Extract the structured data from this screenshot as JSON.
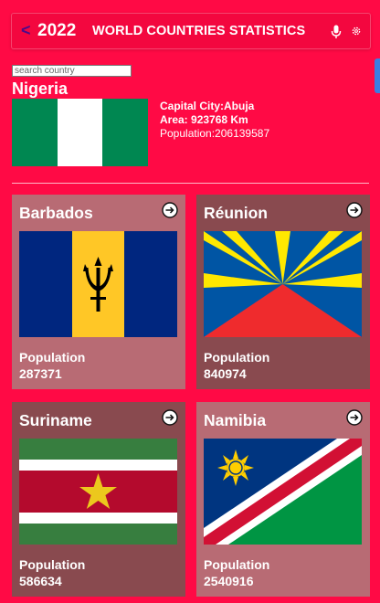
{
  "header": {
    "back_glyph": "<",
    "year": "2022",
    "title": "WORLD COUNTRIES STATISTICS",
    "icons": [
      "chevron-left-icon",
      "microphone-icon",
      "gear-icon"
    ]
  },
  "search": {
    "placeholder": "search country",
    "value": ""
  },
  "selected": {
    "name": "Nigeria",
    "capital": "Capital City:Abuja",
    "area": "Area: 923768 Km",
    "population": "Population:206139587",
    "flag_colors": [
      "#008751",
      "#ffffff",
      "#008751"
    ]
  },
  "cards": [
    {
      "name": "Barbados",
      "population_label": "Population",
      "population": "287371",
      "flag": "barbados-flag"
    },
    {
      "name": "Réunion",
      "population_label": "Population",
      "population": "840974",
      "flag": "reunion-flag"
    },
    {
      "name": "Suriname",
      "population_label": "Population",
      "population": "586634",
      "flag": "suriname-flag"
    },
    {
      "name": "Namibia",
      "population_label": "Population",
      "population": "2540916",
      "flag": "namibia-flag"
    }
  ],
  "colors": {
    "background": "#ff0a45",
    "card_light": "#b86b74",
    "card_dark": "#894a4f",
    "accent": "#3a7ee2"
  }
}
